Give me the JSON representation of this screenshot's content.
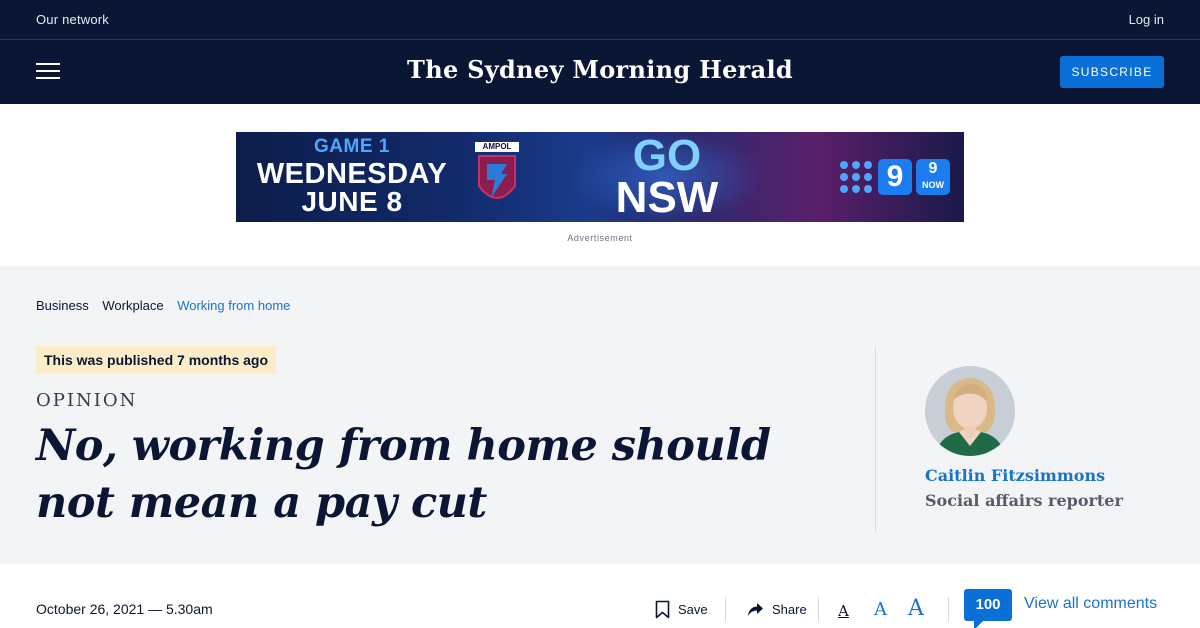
{
  "topbar": {
    "network_label": "Our network",
    "login_label": "Log in"
  },
  "masthead": {
    "title": "The Sydney Morning Herald",
    "subscribe_label": "SUBSCRIBE"
  },
  "advert": {
    "line1": "GAME 1",
    "line2": "WEDNESDAY",
    "line3": "JUNE 8",
    "sponsor": "AMPOL",
    "slogan_top": "GO",
    "slogan_bottom": "NSW",
    "network_logo": "9",
    "network_now_top": "9",
    "network_now_bottom": "NOW",
    "label": "Advertisement"
  },
  "breadcrumb": {
    "items": [
      "Business",
      "Workplace",
      "Working from home"
    ]
  },
  "article": {
    "published_notice": "This was published 7 months ago",
    "kicker": "OPINION",
    "headline": "No, working from home should not mean a pay cut",
    "date": "October 26, 2021 — 5.30am"
  },
  "author": {
    "name": "Caitlin Fitzsimmons",
    "role": "Social affairs reporter"
  },
  "tools": {
    "save_label": "Save",
    "share_label": "Share",
    "font_small": "A",
    "font_medium": "A",
    "font_large": "A",
    "comment_count": "100",
    "view_comments_label": "View all comments"
  },
  "colors": {
    "navy": "#0a1633",
    "brand_blue": "#0a6fd6",
    "link_blue": "#1a73c9",
    "notice_bg": "#fbedc7"
  },
  "icons": [
    "menu-icon",
    "bookmark-icon",
    "share-arrow-icon",
    "comment-bubble-icon"
  ]
}
